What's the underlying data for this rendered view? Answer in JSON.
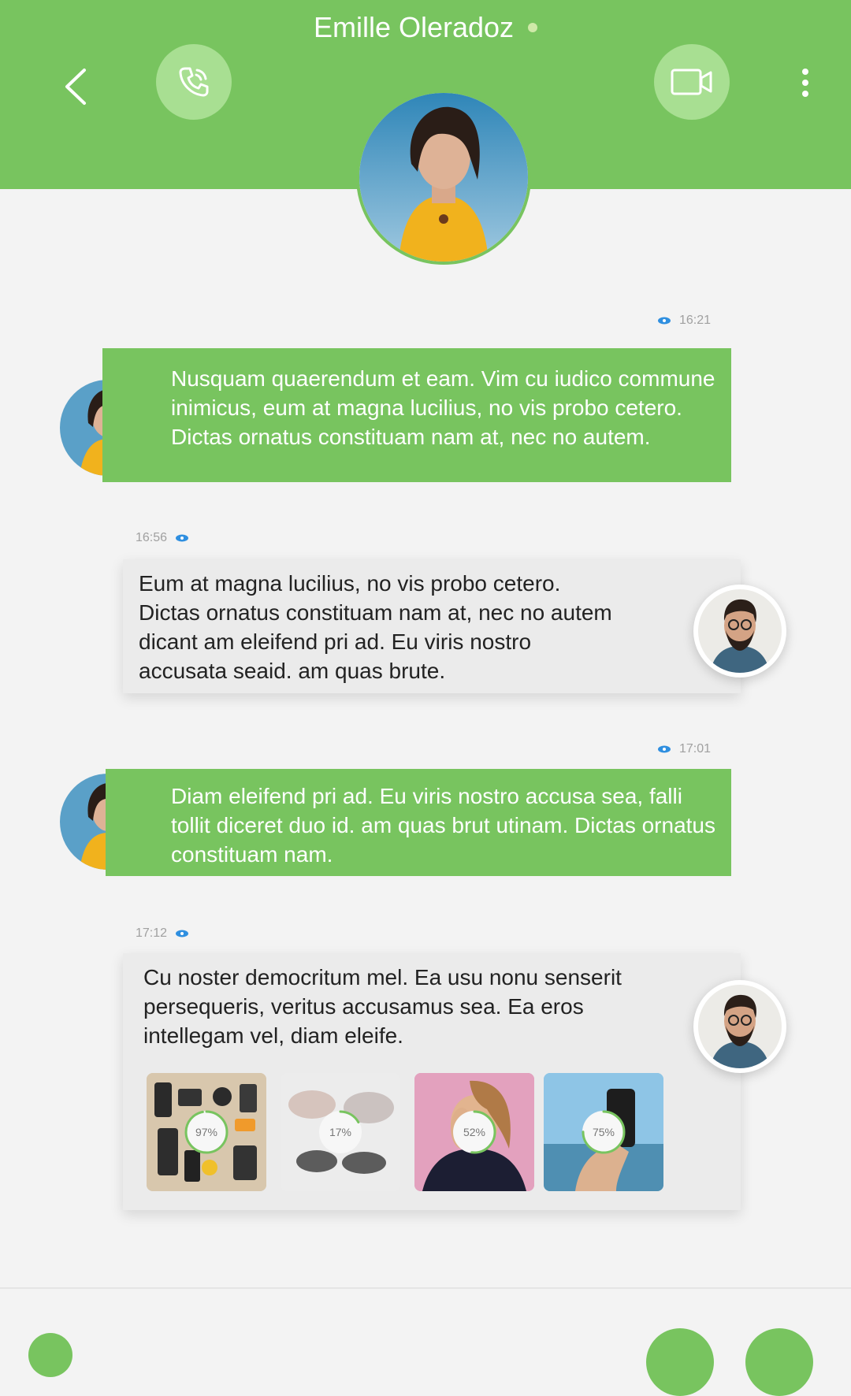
{
  "header": {
    "title": "Emille Oleradoz",
    "icons": {
      "back": "chevron-left-icon",
      "call": "phone-icon",
      "video": "video-camera-icon",
      "menu": "more-vertical-icon"
    },
    "colors": {
      "primary": "#78c45f",
      "button": "#a8df92",
      "online": "#cfe9a8"
    }
  },
  "messages": [
    {
      "direction": "incoming",
      "time": "16:21",
      "text": "Nusquam quaerendum et eam. Vim cu iudico commune inimicus, eum at magna lucilius, no vis probo cetero. Dictas ornatus constituam nam at, nec no autem."
    },
    {
      "direction": "outgoing",
      "time": "16:56",
      "text": "Eum at magna lucilius, no vis probo cetero. Dictas ornatus constituam nam at, nec no autem dicant am eleifend pri ad. Eu viris nostro accusata seaid. am quas brute."
    },
    {
      "direction": "incoming",
      "time": "17:01",
      "text": "Diam eleifend pri ad. Eu viris nostro accusa sea, falli tollit diceret duo id. am quas brut utinam. Dictas ornatus constituam nam."
    },
    {
      "direction": "outgoing",
      "time": "17:12",
      "text": "Cu noster democritum mel. Ea usu nonu senserit persequeris, veritus accusamus sea. Ea eros intellegam vel, diam eleife.",
      "attachments": [
        {
          "progress_label": "97%",
          "progress": 0.97
        },
        {
          "progress_label": "17%",
          "progress": 0.17
        },
        {
          "progress_label": "52%",
          "progress": 0.52
        },
        {
          "progress_label": "75%",
          "progress": 0.75
        }
      ]
    }
  ]
}
